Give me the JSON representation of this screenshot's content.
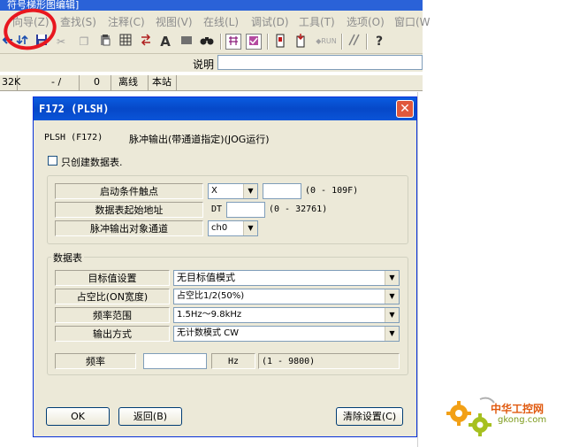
{
  "app": {
    "title_fragment": "符号梯形图编辑]"
  },
  "menu": [
    {
      "label": "向导(Z)"
    },
    {
      "label": "查找(S)"
    },
    {
      "label": "注释(C)"
    },
    {
      "label": "视图(V)"
    },
    {
      "label": "在线(L)"
    },
    {
      "label": "调试(D)"
    },
    {
      "label": "工具(T)"
    },
    {
      "label": "选项(O)"
    },
    {
      "label": "窗口(W"
    }
  ],
  "toolbar": {
    "icons": [
      "arrow-left-icon",
      "arrow-down-icon",
      "save-icon",
      "cut-icon",
      "copy-icon",
      "paste-icon",
      "grid-icon",
      "swap-icon",
      "text-icon",
      "block-icon",
      "binoculars-icon",
      "monitor-icon",
      "monitor-off-icon",
      "plc-icon",
      "plc-write-icon",
      "run-icon",
      "set-reset-icon",
      "help-icon"
    ],
    "run_label": "◆RUN",
    "text_label": "A",
    "help_label": "?"
  },
  "description": {
    "label": "说明",
    "value": ""
  },
  "status": {
    "size": "32K",
    "position": "- /",
    "count": "0",
    "mode": "离线",
    "station": "本站"
  },
  "dialog": {
    "title": "F172 (PLSH)",
    "instruction": "PLSH (F172)",
    "description": "脉冲输出(带通道指定)(JOG运行)",
    "only_table_label": "只创建数据表.",
    "only_table_checked": false,
    "params": [
      {
        "label": "启动条件触点",
        "type_value": "X",
        "value": "",
        "range": "(0 - 109F)"
      },
      {
        "label": "数据表起始地址",
        "prefix": "DT",
        "value": "",
        "range": "(0 - 32761)"
      },
      {
        "label": "脉冲输出对象通道",
        "value": "ch0"
      }
    ],
    "table_group_label": "数据表",
    "table_rows": [
      {
        "label": "目标值设置",
        "value": "无目标值模式"
      },
      {
        "label": "占空比(ON宽度)",
        "value": "占空比1/2(50%)"
      },
      {
        "label": "频率范围",
        "value": "1.5Hz～9.8kHz"
      },
      {
        "label": "输出方式",
        "value": "无计数模式 CW"
      }
    ],
    "frequency": {
      "label": "频率",
      "value": "",
      "unit": "Hz",
      "range": "(1 - 9800)"
    },
    "buttons": {
      "ok": "OK",
      "back": "返回(B)",
      "clear": "清除设置(C)"
    },
    "close_glyph": "✕"
  },
  "watermark": {
    "cn": "中华工控网",
    "url": "gkong.com"
  },
  "colors": {
    "title_blue": "#0a5ce0",
    "annotation_red": "#e8171f",
    "dialog_bg": "#ece9d8"
  }
}
